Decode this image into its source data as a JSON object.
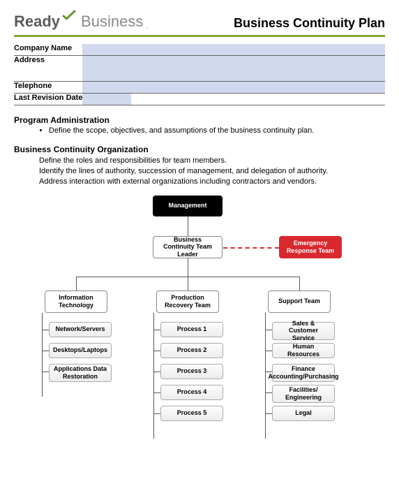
{
  "logo": {
    "ready": "Ready",
    "business": "Business",
    "period": "."
  },
  "title": "Business Continuity Plan",
  "form": {
    "company_label": "Company Name",
    "address_label": "Address",
    "telephone_label": "Telephone",
    "revision_label": "Last Revision Date"
  },
  "section1": {
    "title": "Program Administration",
    "bullet": "Define the scope, objectives, and assumptions of the business continuity plan."
  },
  "section2": {
    "title": "Business Continuity Organization",
    "line1": "Define the roles and responsibilities for team members.",
    "line2": "Identify the lines of authority, succession of management, and delegation of authority.",
    "line3": "Address interaction with external organizations including contractors and vendors."
  },
  "org": {
    "management": "Management",
    "bctl": "Business Continuity Team Leader",
    "ert": "Emergency Response Team",
    "col1_head": "Information Technology",
    "col1_items": [
      "Network/Servers",
      "Desktops/Laptops",
      "Applications Data Restoration"
    ],
    "col2_head": "Production Recovery Team",
    "col2_items": [
      "Process 1",
      "Process 2",
      "Process 3",
      "Process 4",
      "Process 5"
    ],
    "col3_head": "Support Team",
    "col3_items": [
      "Sales & Customer Service",
      "Human Resources",
      "Finance Accounting/Purchasing",
      "Facilities/ Engineering",
      "Legal"
    ]
  }
}
